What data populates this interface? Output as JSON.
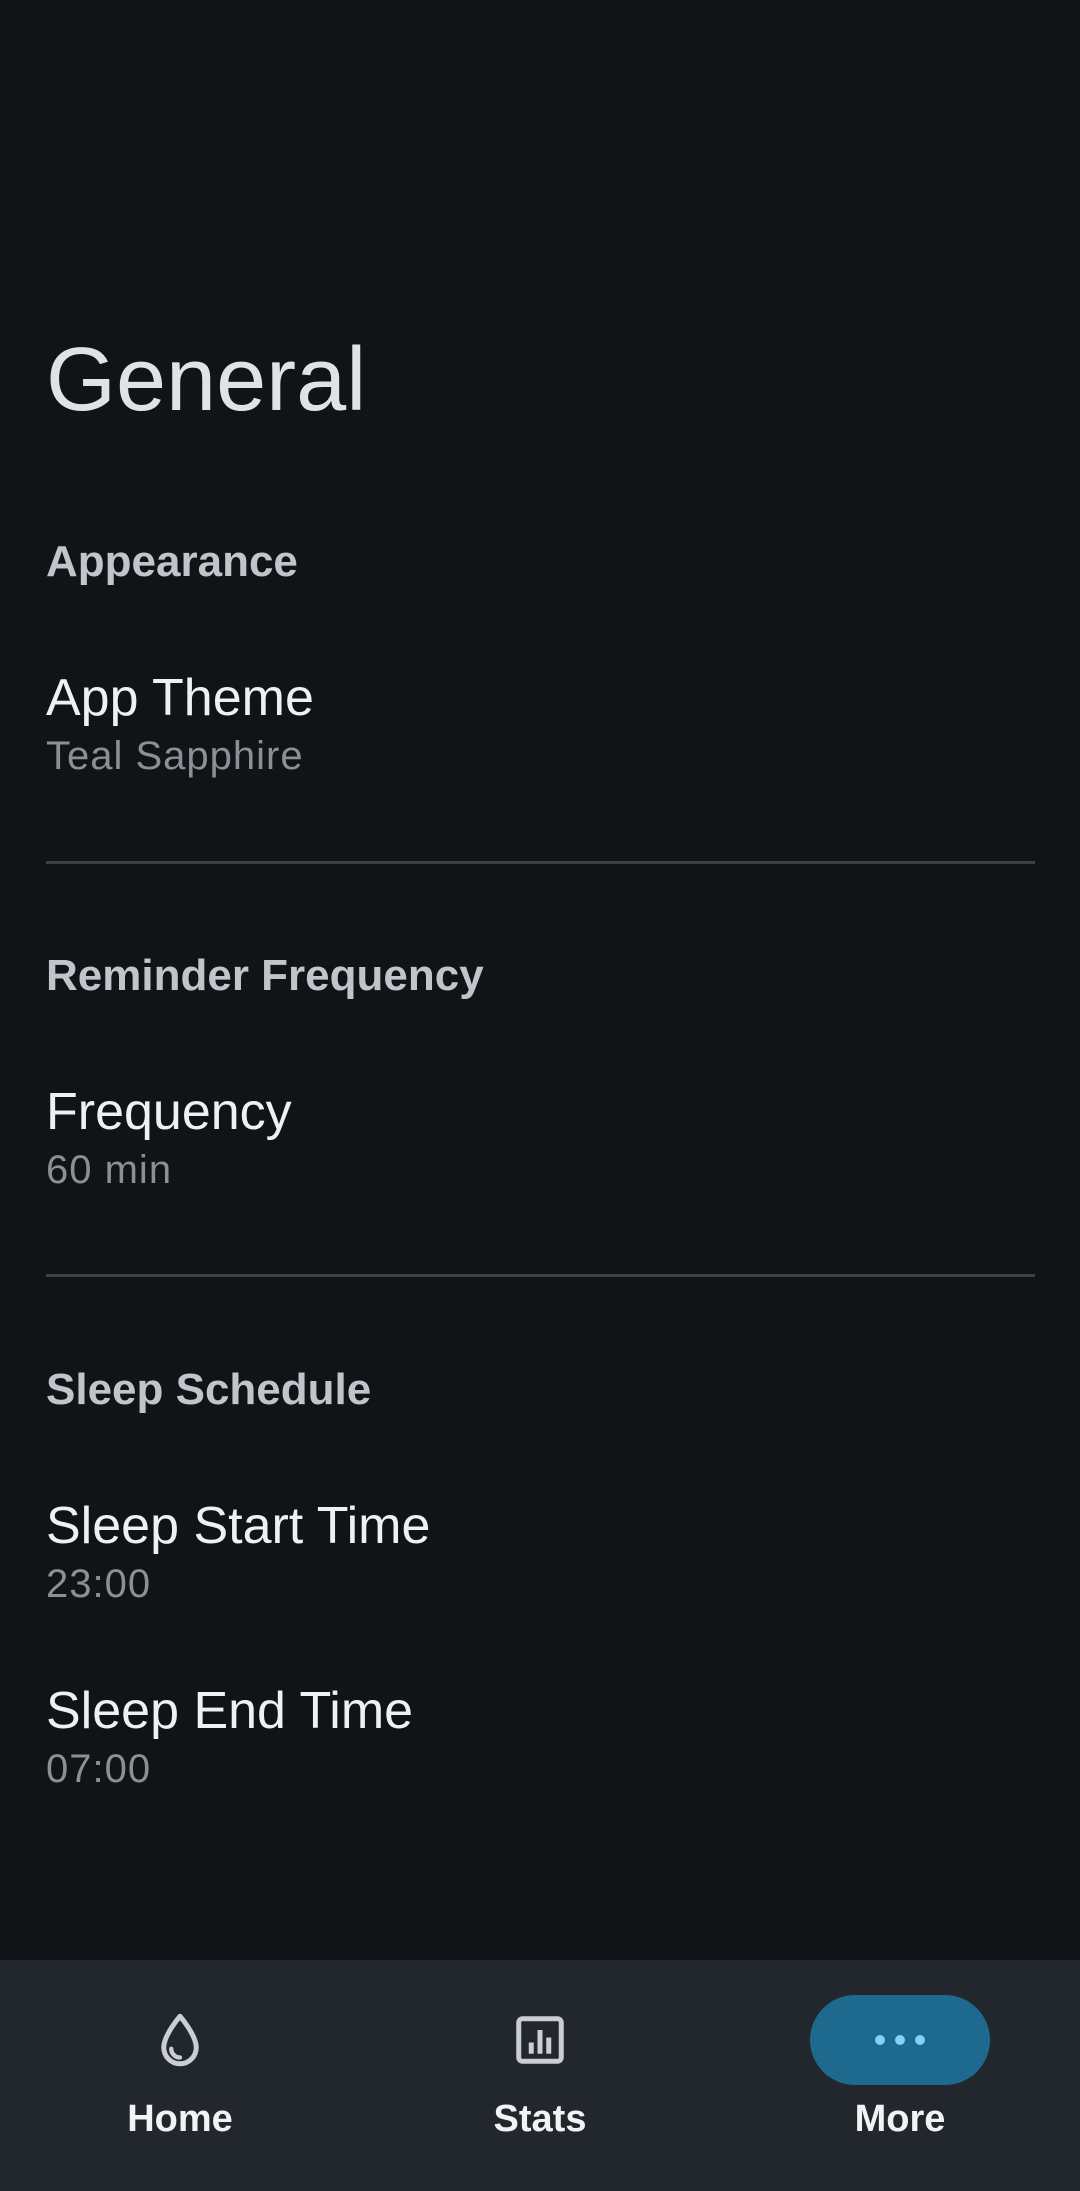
{
  "page": {
    "title": "General"
  },
  "sections": {
    "appearance": {
      "header": "Appearance",
      "items": [
        {
          "title": "App Theme",
          "summary": "Teal Sapphire"
        }
      ]
    },
    "reminder": {
      "header": "Reminder Frequency",
      "items": [
        {
          "title": "Frequency",
          "summary": "60 min"
        }
      ]
    },
    "sleep": {
      "header": "Sleep Schedule",
      "items": [
        {
          "title": "Sleep Start Time",
          "summary": "23:00"
        },
        {
          "title": "Sleep End Time",
          "summary": "07:00"
        }
      ]
    }
  },
  "bottom_nav": {
    "items": [
      {
        "label": "Home",
        "icon": "water-drop-icon",
        "selected": false
      },
      {
        "label": "Stats",
        "icon": "bar-chart-icon",
        "selected": false
      },
      {
        "label": "More",
        "icon": "more-horizontal-icon",
        "selected": true
      }
    ]
  },
  "colors": {
    "background": "#101417",
    "nav_background": "#22272d",
    "accent_pill": "#1d6a8e",
    "accent_icon": "#7fd3f5"
  }
}
